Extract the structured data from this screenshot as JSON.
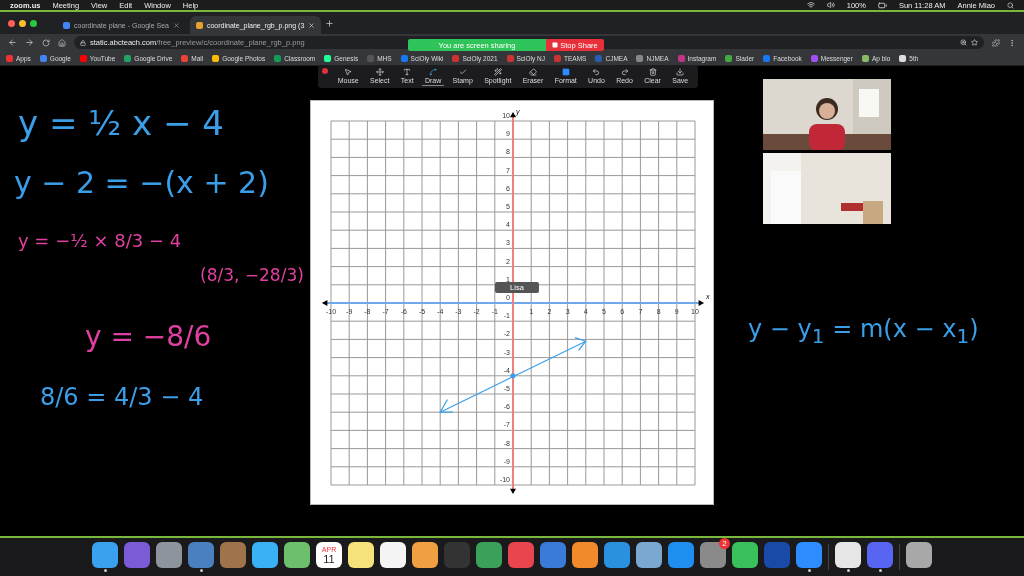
{
  "menubar": {
    "app": "zoom.us",
    "menus": [
      "Meeting",
      "View",
      "Edit",
      "Window",
      "Help"
    ],
    "battery": "100%",
    "clock": "Sun 11:28 AM",
    "user": "Annie Miao"
  },
  "tabs": [
    {
      "title": "coordinate plane - Google Sea",
      "selected": false
    },
    {
      "title": "coordinate_plane_rgb_p.png (3",
      "selected": true
    }
  ],
  "address": {
    "host": "static.abcteach.com",
    "path": "/free_preview/c/coordinate_plane_rgb_p.png"
  },
  "share_banner": {
    "status": "You are screen sharing",
    "stop": "Stop Share"
  },
  "bookmarks": [
    "Apps",
    "Google",
    "YouTube",
    "Google Drive",
    "Mail",
    "Google Photos",
    "Classroom",
    "Genesis",
    "MHS",
    "SciOly Wiki",
    "SciOly 2021",
    "SciOly NJ",
    "TEAMS",
    "CJMEA",
    "NJMEA",
    "Instagram",
    "Slader",
    "Facebook",
    "Messenger",
    "Ap bio",
    "5th"
  ],
  "annotation_tools": [
    {
      "label": "Mouse",
      "selected": false
    },
    {
      "label": "Select",
      "selected": false
    },
    {
      "label": "Text",
      "selected": false
    },
    {
      "label": "Draw",
      "selected": true
    },
    {
      "label": "Stamp",
      "selected": false
    },
    {
      "label": "Spotlight",
      "selected": false
    },
    {
      "label": "Eraser",
      "selected": false
    },
    {
      "label": "Format",
      "selected": false
    },
    {
      "label": "Undo",
      "selected": false
    },
    {
      "label": "Redo",
      "selected": false
    },
    {
      "label": "Clear",
      "selected": false
    },
    {
      "label": "Save",
      "selected": false
    }
  ],
  "handwriting": [
    {
      "text": "y = ½ x − 4",
      "color": "#3a9fe8"
    },
    {
      "text": "y − 2 = −(x + 2)",
      "color": "#3a9fe8"
    },
    {
      "text": "y = −½ × 8/3 − 4",
      "color": "#e040a0"
    },
    {
      "text": "(8/3, −28/3)",
      "color": "#e040a0"
    },
    {
      "text": "y = −8/6",
      "color": "#e040a0"
    },
    {
      "text": "8/6 = 4/3 − 4",
      "color": "#3a9fe8"
    },
    {
      "text": "y − y$_{1}$ = m(x − x$_{1}$)",
      "color": "#3a9fe8"
    }
  ],
  "graph": {
    "x_axis": "x",
    "y_axis": "y",
    "x_ticks": [
      "-10",
      "-9",
      "-8",
      "-7",
      "-6",
      "-5",
      "-4",
      "-3",
      "-2",
      "-1",
      "1",
      "2",
      "3",
      "4",
      "5",
      "6",
      "7",
      "8",
      "9",
      "10"
    ],
    "y_ticks": [
      "10",
      "9",
      "8",
      "7",
      "6",
      "5",
      "4",
      "3",
      "2",
      "1",
      "0",
      "-1",
      "-2",
      "-3",
      "-4",
      "-5",
      "-6",
      "-7",
      "-8",
      "-9",
      "-10"
    ],
    "cursor_label": "Lisa"
  },
  "dock": [
    {
      "color": "#3aa0f0",
      "running": true
    },
    {
      "color": "#7a5cd6",
      "running": false
    },
    {
      "color": "#8e949c",
      "running": false
    },
    {
      "color": "#4a80c0",
      "running": true
    },
    {
      "color": "#a0744a",
      "running": false
    },
    {
      "color": "#3ab0f5",
      "running": false
    },
    {
      "color": "#6cc06c",
      "running": false
    },
    {
      "color": "#ffffff",
      "running": false,
      "month": "APR",
      "day": "11"
    },
    {
      "color": "#f5e27a",
      "running": false
    },
    {
      "color": "#f4f4f4",
      "running": false
    },
    {
      "color": "#f0a040",
      "running": false
    },
    {
      "color": "#333333",
      "running": false
    },
    {
      "color": "#3aa05a",
      "running": false
    },
    {
      "color": "#e8454f",
      "running": false
    },
    {
      "color": "#3a7ad8",
      "running": false
    },
    {
      "color": "#f08a2a",
      "running": false
    },
    {
      "color": "#2a90e0",
      "running": false
    },
    {
      "color": "#7aa8d0",
      "running": false
    },
    {
      "color": "#1e8ef0",
      "running": false
    },
    {
      "color": "#8a8a8a",
      "running": false,
      "badge": "2"
    },
    {
      "color": "#3ac05a",
      "running": false
    },
    {
      "color": "#1a4aa8",
      "running": false
    },
    {
      "color": "#2d8cff",
      "running": true
    },
    {
      "color": "#e6e6e6",
      "running": true
    },
    {
      "color": "#5865f2",
      "running": true
    },
    {
      "color": "#a8a8a8",
      "running": false
    }
  ]
}
